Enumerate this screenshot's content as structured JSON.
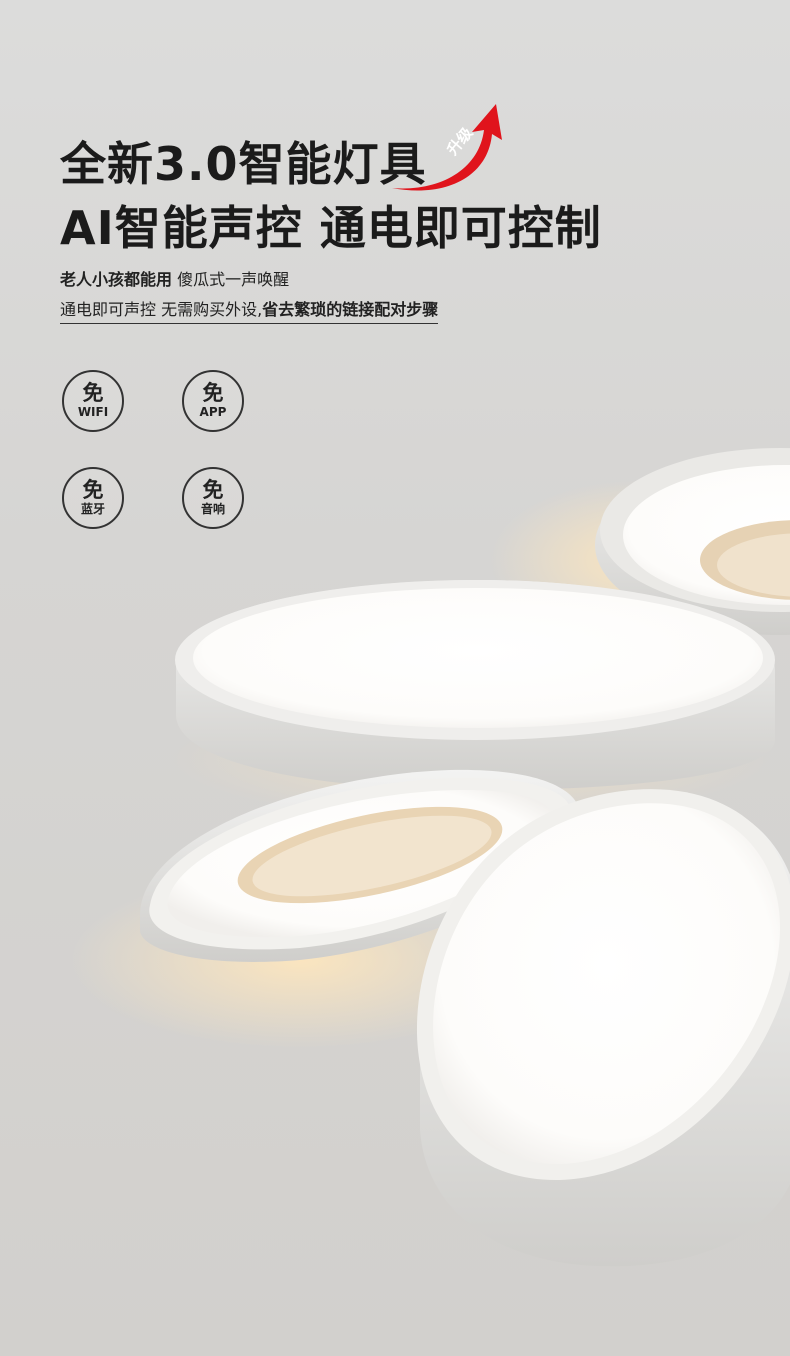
{
  "headline": {
    "line1": "全新3.0智能灯具",
    "line2": "AI智能声控 通电即可控制",
    "upgrade_tag": "升级"
  },
  "subheadline": {
    "line1_bold": "老人小孩都能用",
    "line1_normal": "傻瓜式一声唤醒",
    "line2_normal": "通电即可声控 无需购买外设,",
    "line2_bold": "省去繁琐的链接配对步骤"
  },
  "features": [
    {
      "top": "免",
      "bottom": "WIFI"
    },
    {
      "top": "免",
      "bottom": "APP"
    },
    {
      "top": "免",
      "bottom": "蓝牙"
    },
    {
      "top": "免",
      "bottom": "音响"
    }
  ],
  "colors": {
    "text": "#1b1b1b",
    "arrow_red": "#e0141c",
    "lamp_glow": "#fff6e6"
  }
}
